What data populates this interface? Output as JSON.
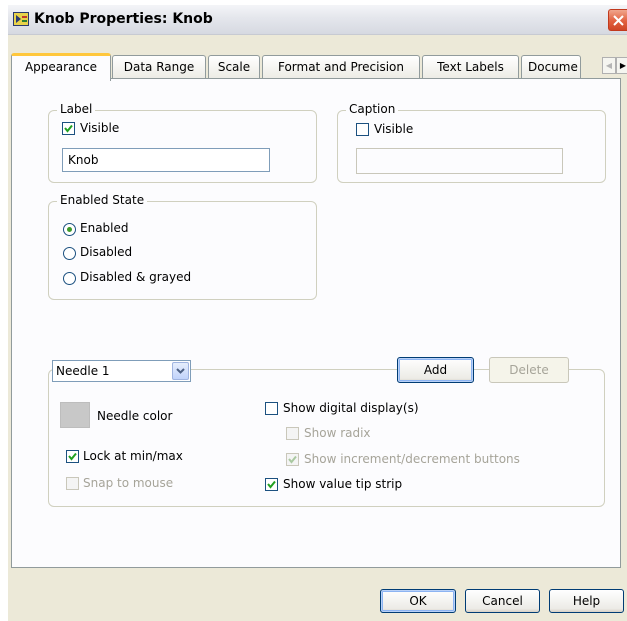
{
  "window": {
    "title": "Knob Properties: Knob"
  },
  "tabs": [
    {
      "label": "Appearance",
      "active": true
    },
    {
      "label": "Data Range",
      "active": false
    },
    {
      "label": "Scale",
      "active": false
    },
    {
      "label": "Format and Precision",
      "active": false
    },
    {
      "label": "Text Labels",
      "active": false
    },
    {
      "label": "Docume",
      "active": false
    }
  ],
  "label_group": {
    "legend": "Label",
    "visible_label": "Visible",
    "visible_checked": true,
    "text_value": "Knob"
  },
  "caption_group": {
    "legend": "Caption",
    "visible_label": "Visible",
    "visible_checked": false,
    "text_value": ""
  },
  "enabled_state": {
    "legend": "Enabled State",
    "options": [
      {
        "label": "Enabled",
        "selected": true
      },
      {
        "label": "Disabled",
        "selected": false
      },
      {
        "label": "Disabled & grayed",
        "selected": false
      }
    ]
  },
  "needle_group": {
    "selected_needle": "Needle 1",
    "add_label": "Add",
    "delete_label": "Delete",
    "needle_color_label": "Needle color",
    "needle_color": "#c8c8c8",
    "lock_label": "Lock at min/max",
    "lock_checked": true,
    "snap_label": "Snap to mouse",
    "snap_checked": false,
    "show_digital_label": "Show digital display(s)",
    "show_digital_checked": false,
    "show_radix_label": "Show radix",
    "show_radix_checked": false,
    "show_incdec_label": "Show increment/decrement buttons",
    "show_incdec_checked": true,
    "show_tip_label": "Show value tip strip",
    "show_tip_checked": true
  },
  "footer": {
    "ok_label": "OK",
    "cancel_label": "Cancel",
    "help_label": "Help"
  },
  "colors": {
    "accent_tab": "#ffc73c",
    "check_green": "#3d9a2b",
    "close_red": "#e2603f"
  }
}
